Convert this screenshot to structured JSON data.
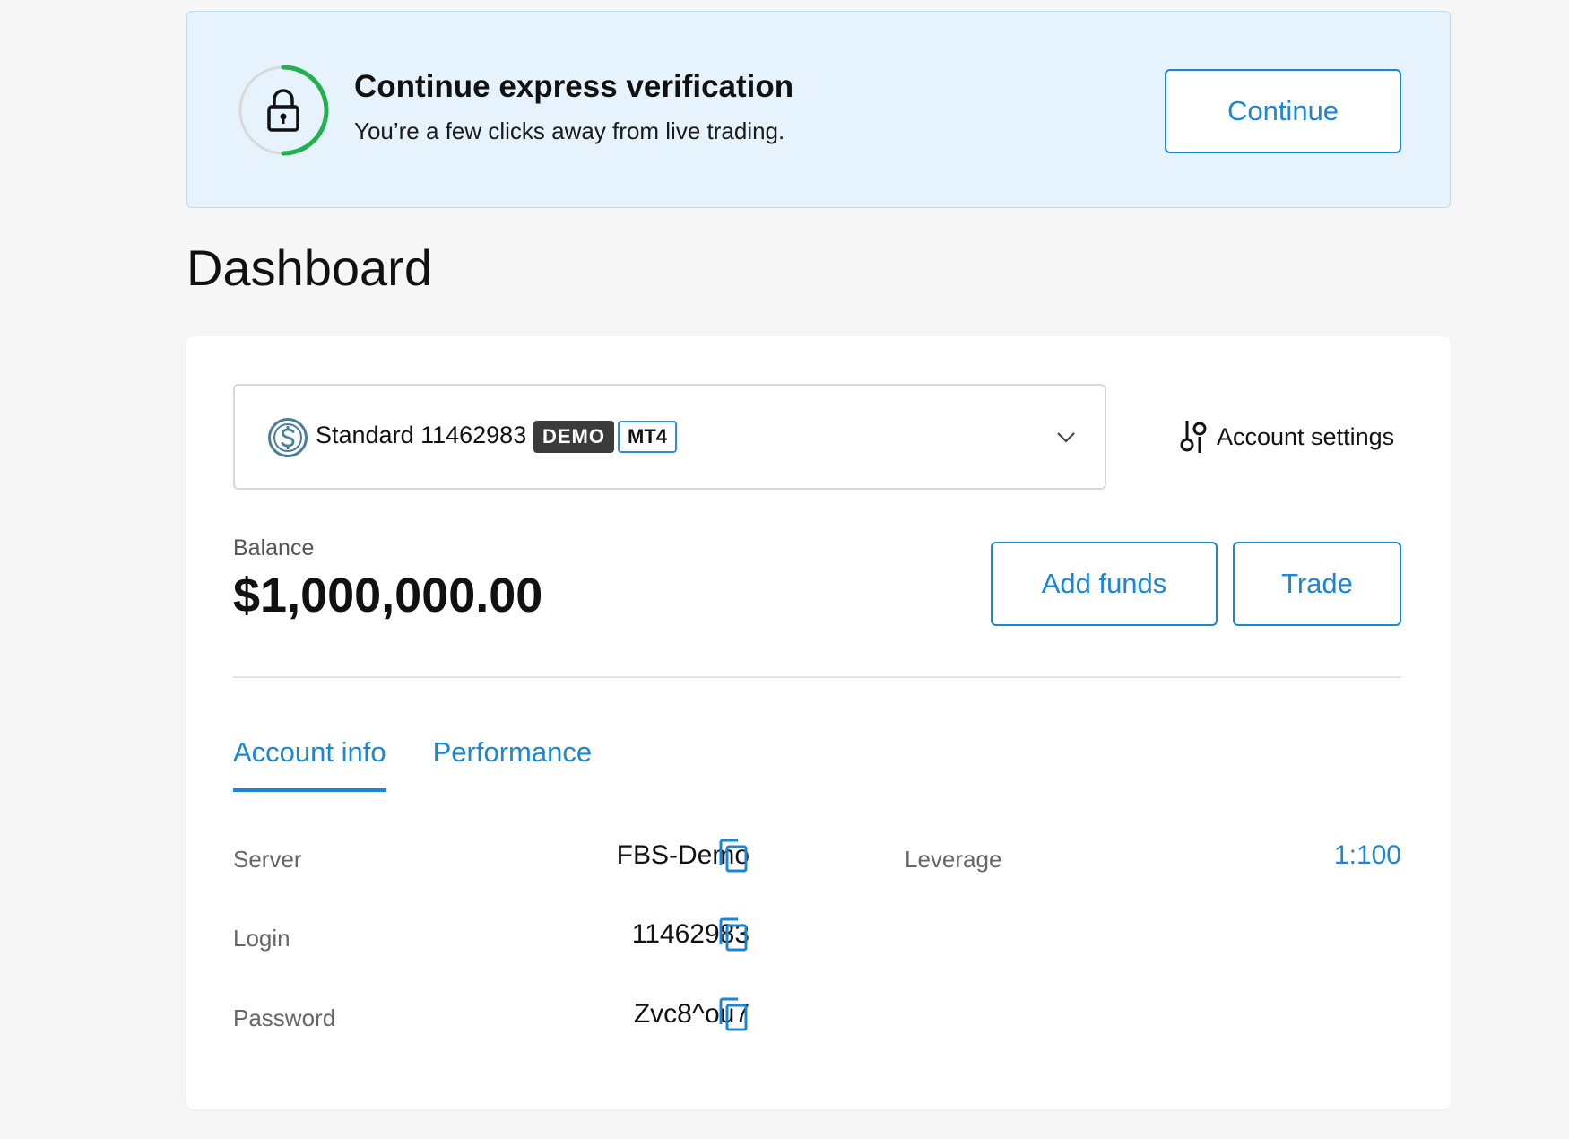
{
  "banner": {
    "title": "Continue express verification",
    "subtitle": "You’re a few clicks away from live trading.",
    "button_label": "Continue",
    "progress_fraction": 0.5,
    "progress_color": "#22b14c"
  },
  "page": {
    "title": "Dashboard"
  },
  "account": {
    "name": "Standard 11462983",
    "badge_demo": "DEMO",
    "badge_platform": "MT4",
    "settings_label": "Account settings"
  },
  "balance": {
    "label": "Balance",
    "value": "$1,000,000.00"
  },
  "actions": {
    "add_funds": "Add funds",
    "trade": "Trade"
  },
  "tabs": [
    {
      "label": "Account info",
      "active": true
    },
    {
      "label": "Performance",
      "active": false
    }
  ],
  "info": {
    "server": {
      "label": "Server",
      "value": "FBS-Demo"
    },
    "login": {
      "label": "Login",
      "value": "11462983"
    },
    "password": {
      "label": "Password",
      "value": "Zvc8^ou7"
    },
    "leverage": {
      "label": "Leverage",
      "value": "1:100"
    }
  },
  "colors": {
    "accent": "#1a87d6",
    "banner_bg": "#e6f3fc",
    "demo_badge": "#3b3b3b"
  },
  "icons": {
    "banner": "lock-icon",
    "account": "dollar-coin-icon",
    "select": "chevron-down-icon",
    "settings": "sliders-icon",
    "copy": "copy-icon"
  }
}
